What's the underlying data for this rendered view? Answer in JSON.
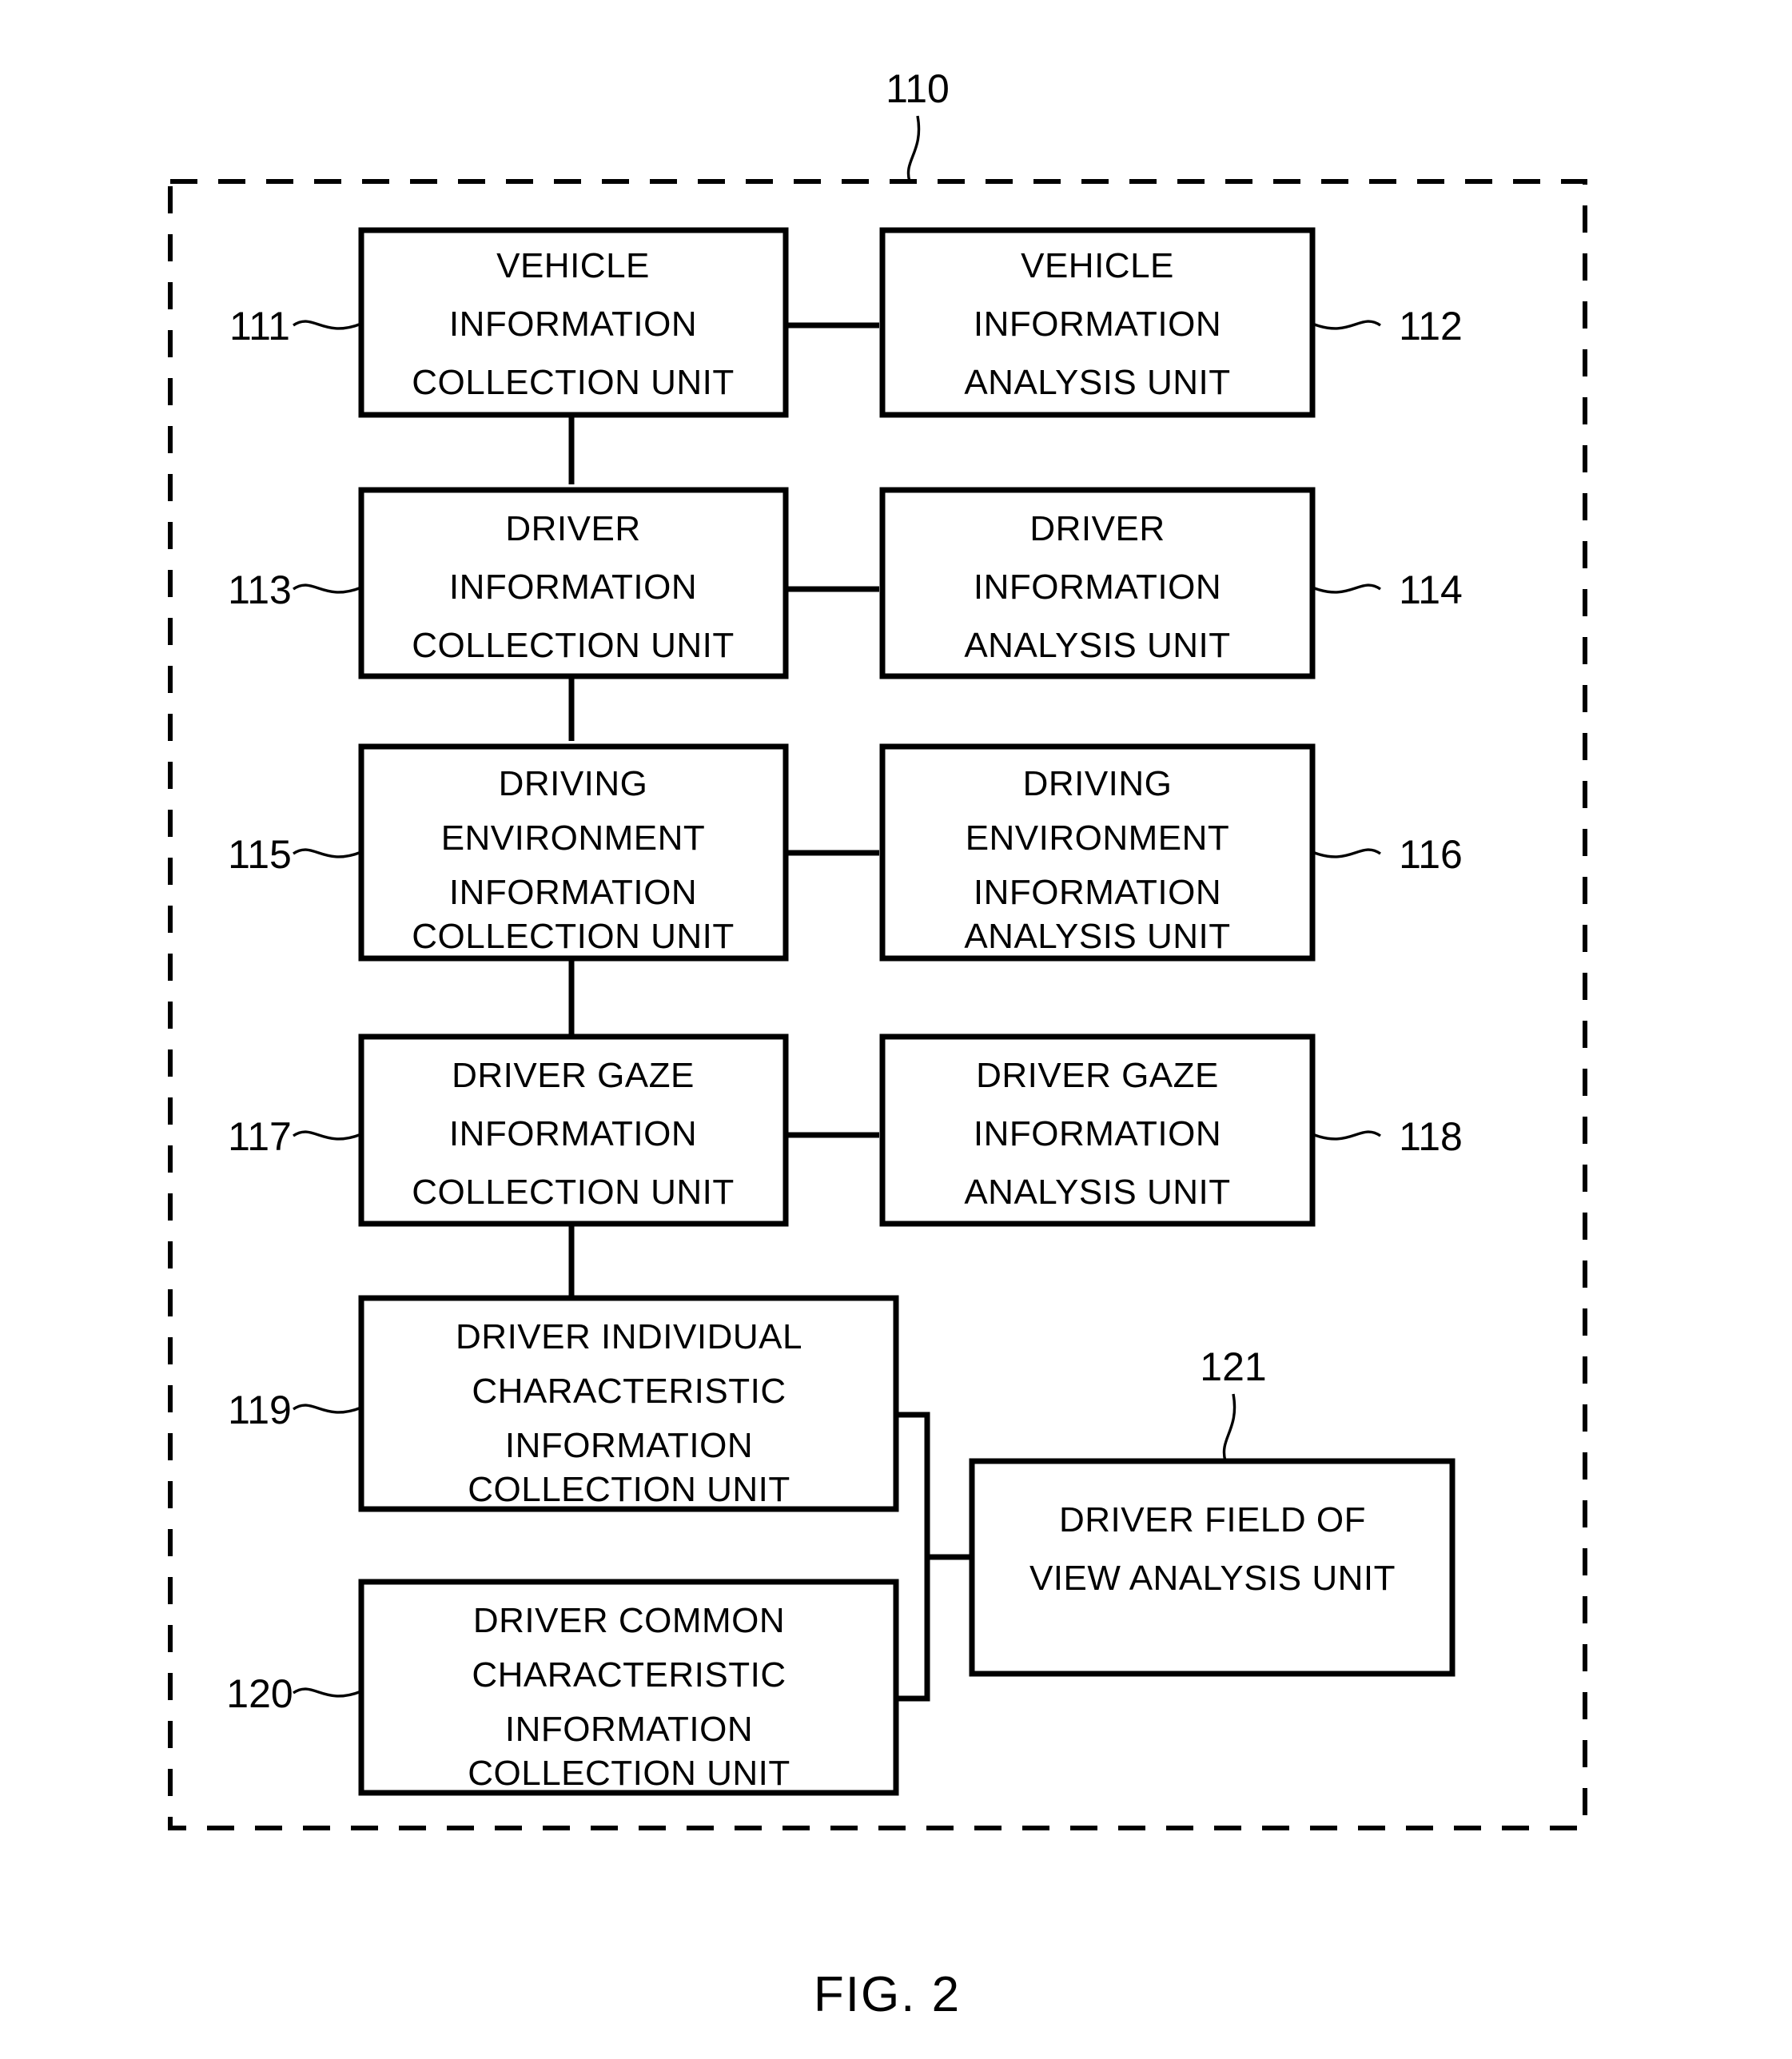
{
  "figure": {
    "caption": "FIG. 2",
    "enclosure_ref": "110"
  },
  "blocks": [
    {
      "ref": "111",
      "name": "vehicle-information-collection-unit",
      "lines": [
        "VEHICLE",
        "INFORMATION",
        "COLLECTION UNIT"
      ]
    },
    {
      "ref": "112",
      "name": "vehicle-information-analysis-unit",
      "lines": [
        "VEHICLE",
        "INFORMATION",
        "ANALYSIS UNIT"
      ]
    },
    {
      "ref": "113",
      "name": "driver-information-collection-unit",
      "lines": [
        "DRIVER",
        "INFORMATION",
        "COLLECTION UNIT"
      ]
    },
    {
      "ref": "114",
      "name": "driver-information-analysis-unit",
      "lines": [
        "DRIVER",
        "INFORMATION",
        "ANALYSIS UNIT"
      ]
    },
    {
      "ref": "115",
      "name": "driving-environment-information-collection-unit",
      "lines": [
        "DRIVING",
        "ENVIRONMENT",
        "INFORMATION",
        "COLLECTION UNIT"
      ]
    },
    {
      "ref": "116",
      "name": "driving-environment-information-analysis-unit",
      "lines": [
        "DRIVING",
        "ENVIRONMENT",
        "INFORMATION",
        "ANALYSIS UNIT"
      ]
    },
    {
      "ref": "117",
      "name": "driver-gaze-information-collection-unit",
      "lines": [
        "DRIVER GAZE",
        "INFORMATION",
        "COLLECTION UNIT"
      ]
    },
    {
      "ref": "118",
      "name": "driver-gaze-information-analysis-unit",
      "lines": [
        "DRIVER GAZE",
        "INFORMATION",
        "ANALYSIS UNIT"
      ]
    },
    {
      "ref": "119",
      "name": "driver-individual-characteristic-information-collection-unit",
      "lines": [
        "DRIVER INDIVIDUAL",
        "CHARACTERISTIC",
        "INFORMATION",
        "COLLECTION UNIT"
      ]
    },
    {
      "ref": "120",
      "name": "driver-common-characteristic-information-collection-unit",
      "lines": [
        "DRIVER COMMON",
        "CHARACTERISTIC",
        "INFORMATION",
        "COLLECTION UNIT"
      ]
    },
    {
      "ref": "121",
      "name": "driver-field-of-view-analysis-unit",
      "lines": [
        "DRIVER FIELD OF",
        "VIEW ANALYSIS UNIT"
      ]
    }
  ],
  "colors": {
    "stroke": "#000000",
    "background": "#ffffff"
  }
}
